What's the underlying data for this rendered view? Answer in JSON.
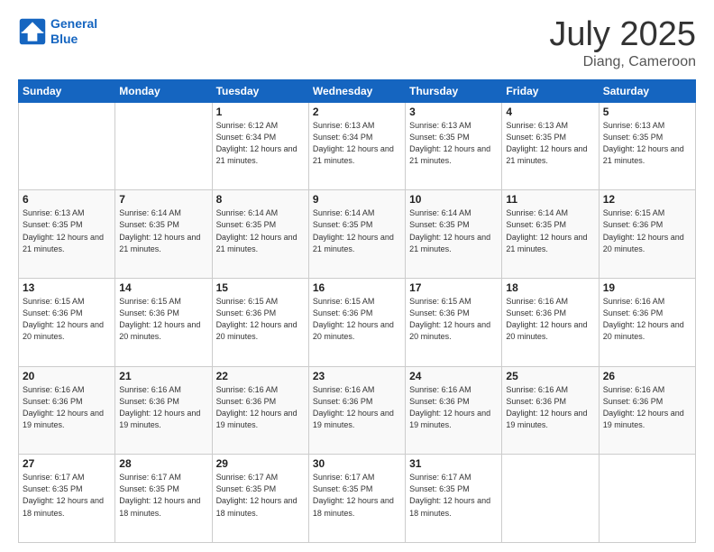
{
  "logo": {
    "line1": "General",
    "line2": "Blue"
  },
  "title": "July 2025",
  "location": "Diang, Cameroon",
  "days_of_week": [
    "Sunday",
    "Monday",
    "Tuesday",
    "Wednesday",
    "Thursday",
    "Friday",
    "Saturday"
  ],
  "weeks": [
    [
      {
        "day": "",
        "info": ""
      },
      {
        "day": "",
        "info": ""
      },
      {
        "day": "1",
        "info": "Sunrise: 6:12 AM\nSunset: 6:34 PM\nDaylight: 12 hours and 21 minutes."
      },
      {
        "day": "2",
        "info": "Sunrise: 6:13 AM\nSunset: 6:34 PM\nDaylight: 12 hours and 21 minutes."
      },
      {
        "day": "3",
        "info": "Sunrise: 6:13 AM\nSunset: 6:35 PM\nDaylight: 12 hours and 21 minutes."
      },
      {
        "day": "4",
        "info": "Sunrise: 6:13 AM\nSunset: 6:35 PM\nDaylight: 12 hours and 21 minutes."
      },
      {
        "day": "5",
        "info": "Sunrise: 6:13 AM\nSunset: 6:35 PM\nDaylight: 12 hours and 21 minutes."
      }
    ],
    [
      {
        "day": "6",
        "info": "Sunrise: 6:13 AM\nSunset: 6:35 PM\nDaylight: 12 hours and 21 minutes."
      },
      {
        "day": "7",
        "info": "Sunrise: 6:14 AM\nSunset: 6:35 PM\nDaylight: 12 hours and 21 minutes."
      },
      {
        "day": "8",
        "info": "Sunrise: 6:14 AM\nSunset: 6:35 PM\nDaylight: 12 hours and 21 minutes."
      },
      {
        "day": "9",
        "info": "Sunrise: 6:14 AM\nSunset: 6:35 PM\nDaylight: 12 hours and 21 minutes."
      },
      {
        "day": "10",
        "info": "Sunrise: 6:14 AM\nSunset: 6:35 PM\nDaylight: 12 hours and 21 minutes."
      },
      {
        "day": "11",
        "info": "Sunrise: 6:14 AM\nSunset: 6:35 PM\nDaylight: 12 hours and 21 minutes."
      },
      {
        "day": "12",
        "info": "Sunrise: 6:15 AM\nSunset: 6:36 PM\nDaylight: 12 hours and 20 minutes."
      }
    ],
    [
      {
        "day": "13",
        "info": "Sunrise: 6:15 AM\nSunset: 6:36 PM\nDaylight: 12 hours and 20 minutes."
      },
      {
        "day": "14",
        "info": "Sunrise: 6:15 AM\nSunset: 6:36 PM\nDaylight: 12 hours and 20 minutes."
      },
      {
        "day": "15",
        "info": "Sunrise: 6:15 AM\nSunset: 6:36 PM\nDaylight: 12 hours and 20 minutes."
      },
      {
        "day": "16",
        "info": "Sunrise: 6:15 AM\nSunset: 6:36 PM\nDaylight: 12 hours and 20 minutes."
      },
      {
        "day": "17",
        "info": "Sunrise: 6:15 AM\nSunset: 6:36 PM\nDaylight: 12 hours and 20 minutes."
      },
      {
        "day": "18",
        "info": "Sunrise: 6:16 AM\nSunset: 6:36 PM\nDaylight: 12 hours and 20 minutes."
      },
      {
        "day": "19",
        "info": "Sunrise: 6:16 AM\nSunset: 6:36 PM\nDaylight: 12 hours and 20 minutes."
      }
    ],
    [
      {
        "day": "20",
        "info": "Sunrise: 6:16 AM\nSunset: 6:36 PM\nDaylight: 12 hours and 19 minutes."
      },
      {
        "day": "21",
        "info": "Sunrise: 6:16 AM\nSunset: 6:36 PM\nDaylight: 12 hours and 19 minutes."
      },
      {
        "day": "22",
        "info": "Sunrise: 6:16 AM\nSunset: 6:36 PM\nDaylight: 12 hours and 19 minutes."
      },
      {
        "day": "23",
        "info": "Sunrise: 6:16 AM\nSunset: 6:36 PM\nDaylight: 12 hours and 19 minutes."
      },
      {
        "day": "24",
        "info": "Sunrise: 6:16 AM\nSunset: 6:36 PM\nDaylight: 12 hours and 19 minutes."
      },
      {
        "day": "25",
        "info": "Sunrise: 6:16 AM\nSunset: 6:36 PM\nDaylight: 12 hours and 19 minutes."
      },
      {
        "day": "26",
        "info": "Sunrise: 6:16 AM\nSunset: 6:36 PM\nDaylight: 12 hours and 19 minutes."
      }
    ],
    [
      {
        "day": "27",
        "info": "Sunrise: 6:17 AM\nSunset: 6:35 PM\nDaylight: 12 hours and 18 minutes."
      },
      {
        "day": "28",
        "info": "Sunrise: 6:17 AM\nSunset: 6:35 PM\nDaylight: 12 hours and 18 minutes."
      },
      {
        "day": "29",
        "info": "Sunrise: 6:17 AM\nSunset: 6:35 PM\nDaylight: 12 hours and 18 minutes."
      },
      {
        "day": "30",
        "info": "Sunrise: 6:17 AM\nSunset: 6:35 PM\nDaylight: 12 hours and 18 minutes."
      },
      {
        "day": "31",
        "info": "Sunrise: 6:17 AM\nSunset: 6:35 PM\nDaylight: 12 hours and 18 minutes."
      },
      {
        "day": "",
        "info": ""
      },
      {
        "day": "",
        "info": ""
      }
    ]
  ]
}
